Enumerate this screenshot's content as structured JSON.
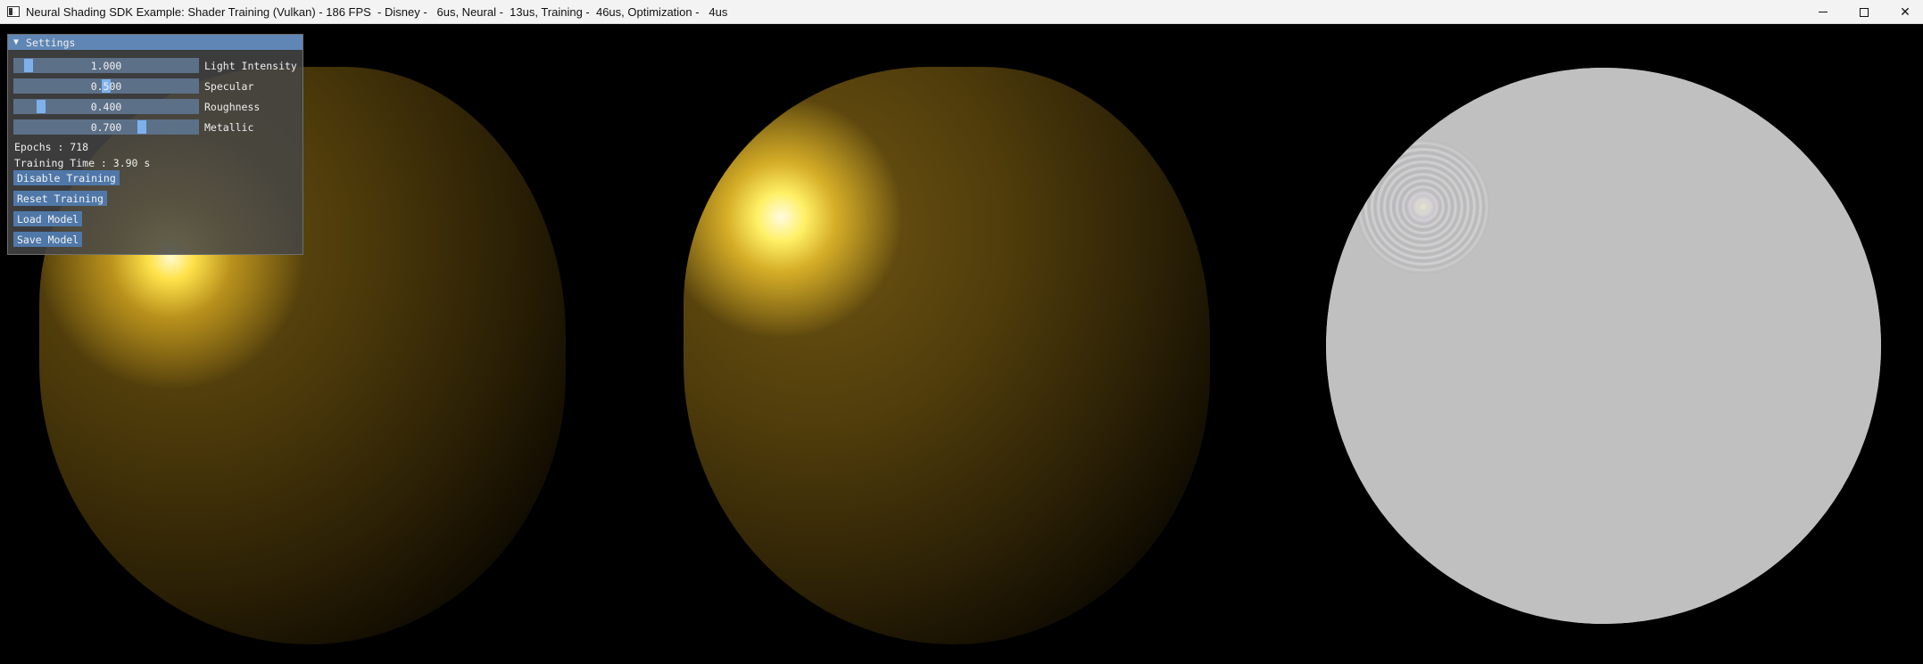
{
  "window": {
    "title": "Neural Shading SDK Example: Shader Training (Vulkan) - 186 FPS  - Disney -   6us, Neural -  13us, Training -  46us, Optimization -   4us",
    "minimize_icon": "minimize-icon",
    "maximize_icon": "maximize-icon",
    "close_icon": "close-icon",
    "close_glyph": "✕"
  },
  "settings": {
    "header": "Settings",
    "collapse_glyph": "▼",
    "sliders": [
      {
        "label": "Light Intensity",
        "value": "1.000",
        "fraction": 0.06
      },
      {
        "label": "Specular",
        "value": "0.500",
        "fraction": 0.5
      },
      {
        "label": "Roughness",
        "value": "0.400",
        "fraction": 0.13
      },
      {
        "label": "Metallic",
        "value": "0.700",
        "fraction": 0.7
      }
    ],
    "epochs_text": "Epochs : 718",
    "training_time_text": "Training Time : 3.90 s",
    "buttons": {
      "disable_training": "Disable Training",
      "reset_training": "Reset Training",
      "load_model": "Load Model",
      "save_model": "Save Model"
    }
  },
  "colors": {
    "panel_header": "#5f86b5",
    "slider_track": "#5c7088",
    "slider_grab": "#7eb1ec",
    "button": "#4f78a8",
    "gold_highlight": "#fff066",
    "sphere_gray": "#c2c2c2"
  }
}
